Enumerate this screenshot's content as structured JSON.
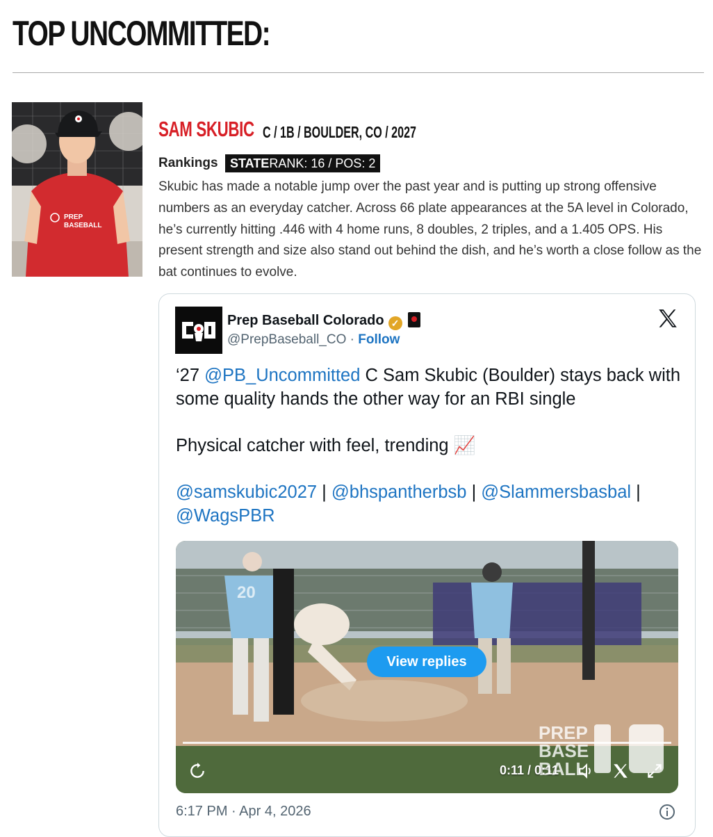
{
  "page": {
    "title": "TOP UNCOMMITTED:"
  },
  "player": {
    "name": "SAM SKUBIC",
    "meta": "C / 1B / BOULDER, CO / 2027",
    "rankings_label": "Rankings",
    "rank_state_bold": "STATE",
    "rank_text": "RANK: 16 / POS: 2",
    "blurb": "Skubic has made a notable jump over the past year and is putting up strong offensive numbers as an everyday catcher. Across 66 plate appearances at the 5A level in Colorado, he’s currently hitting .446 with 4 home runs, 8 doubles, 2 triples, and a 1.405 OPS. His present strength and size also stand out behind the dish, and he’s worth a close follow as the bat continues to evolve.",
    "photo_shirt_text_1": "PREP",
    "photo_shirt_text_2": "BASEBALL"
  },
  "tweet": {
    "account_name": "Prep Baseball Colorado",
    "handle": "@PrepBaseball_CO",
    "separator": " · ",
    "follow_label": "Follow",
    "line1_prefix": "‘27 ",
    "line1_mention": "@PB_Uncommitted",
    "line1_rest": " C Sam Skubic (Boulder) stays back with some quality hands the other way for an RBI single",
    "line2": "Physical catcher with feel, trending 📈",
    "mentions": [
      "@samskubic2027",
      "@bhspantherbsb",
      "@Slammersbasbal",
      "@WagsPBR"
    ],
    "mention_sep": " | ",
    "video": {
      "view_replies_label": "View replies",
      "time": "0:11 / 0:11",
      "progress": 1.0,
      "watermark_1": "PREP",
      "watermark_2": "BASE",
      "watermark_3": "BALL",
      "jersey_number": "20"
    },
    "timestamp": "6:17 PM · Apr 4, 2026"
  },
  "colors": {
    "brand_red": "#d71f26",
    "link_blue": "#1d74c2",
    "button_blue": "#1d9bf0"
  },
  "icons": [
    "verified-badge-icon",
    "x-logo-icon",
    "replay-icon",
    "volume-icon",
    "fullscreen-icon",
    "info-icon"
  ]
}
